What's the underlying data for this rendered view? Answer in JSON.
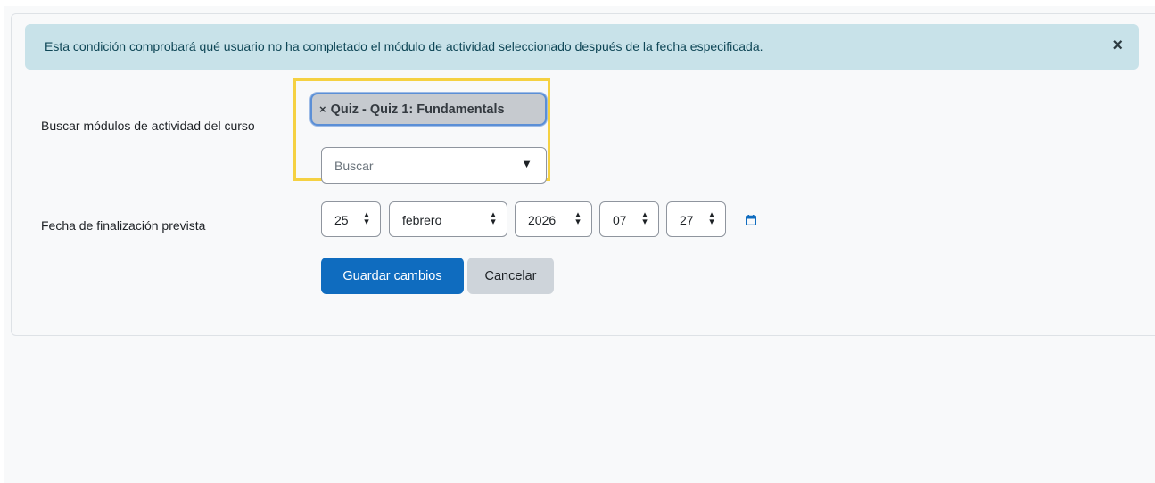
{
  "alert": {
    "message": "Esta condición comprobará qué usuario no ha completado el módulo de actividad seleccionado después de la fecha especificada.",
    "close_icon": "×"
  },
  "activity_search": {
    "label": "Buscar módulos de actividad del curso",
    "selected_chip": {
      "remove_icon": "×",
      "text": "Quiz - Quiz 1: Fundamentals"
    },
    "placeholder": "Buscar",
    "dropdown_icon": "▼"
  },
  "due_date": {
    "label": "Fecha de finalización prevista",
    "day": "25",
    "month": "febrero",
    "year": "2026",
    "hour": "07",
    "minute": "27",
    "calendar_icon": "calendar-icon"
  },
  "actions": {
    "save_label": "Guardar cambios",
    "cancel_label": "Cancelar"
  },
  "colors": {
    "primary": "#0f6cbf",
    "alert_bg": "#c8e2e9",
    "highlight": "#f5d142"
  }
}
